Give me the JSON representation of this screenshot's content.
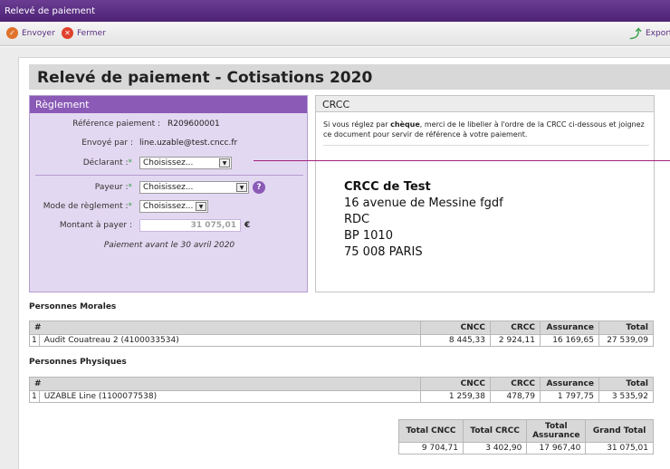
{
  "window": {
    "title": "Relevé de paiement"
  },
  "toolbar": {
    "send_label": "Envoyer",
    "close_label": "Fermer",
    "export_label": "Export"
  },
  "doc": {
    "title": "Relevé de paiement - Cotisations 2020"
  },
  "reglement": {
    "heading": "Règlement",
    "ref_label": "Référence paiement :",
    "ref_value": "R209600001",
    "sent_by_label": "Envoyé par :",
    "sent_by_value": "line.uzable@test.cncc.fr",
    "declarant_label": "Déclarant :",
    "declarant_value": "Choisissez...",
    "payer_label": "Payeur :",
    "payer_value": "Choisissez...",
    "mode_label": "Mode de règlement :",
    "mode_value": "Choisissez...",
    "amount_label": "Montant à payer :",
    "amount_value": "31 075,01",
    "currency": "€",
    "deadline": "Paiement avant le 30 avril 2020",
    "required_mark": "*",
    "help_mark": "?"
  },
  "crcc": {
    "heading": "CRCC",
    "text_before": "Si vous réglez par ",
    "text_bold": "chèque",
    "text_after": ", merci de le libeller à l'ordre de la CRCC ci-dessous et joignez ce document pour servir de référence à votre paiement.",
    "address": [
      "CRCC de Test",
      "16 avenue de Messine fgdf",
      "RDC",
      "BP 1010",
      "75 008 PARIS"
    ]
  },
  "morales": {
    "title": "Personnes Morales",
    "headers": [
      "#",
      "CNCC",
      "CRCC",
      "Assurance",
      "Total"
    ],
    "rows": [
      {
        "num": "1",
        "name": "Audit Couatreau 2 (4100033534)",
        "cncc": "8 445,33",
        "crcc": "2 924,11",
        "assurance": "16 169,65",
        "total": "27 539,09"
      }
    ]
  },
  "physiques": {
    "title": "Personnes Physiques",
    "headers": [
      "#",
      "CNCC",
      "CRCC",
      "Assurance",
      "Total"
    ],
    "rows": [
      {
        "num": "1",
        "name": "UZABLE Line (1100077538)",
        "cncc": "1 259,38",
        "crcc": "478,79",
        "assurance": "1 797,75",
        "total": "3 535,92"
      }
    ]
  },
  "totals": {
    "headers": [
      "Total CNCC",
      "Total CRCC",
      "Total Assurance",
      "Grand Total"
    ],
    "values": [
      "9 704,71",
      "3 402,90",
      "17 967,40",
      "31 075,01"
    ]
  },
  "colors": {
    "titlebar": "#5b2d86",
    "accent": "#8a5ab6",
    "panel": "#e3d8f1",
    "connector": "#a3207b",
    "required": "#3aa04a"
  }
}
